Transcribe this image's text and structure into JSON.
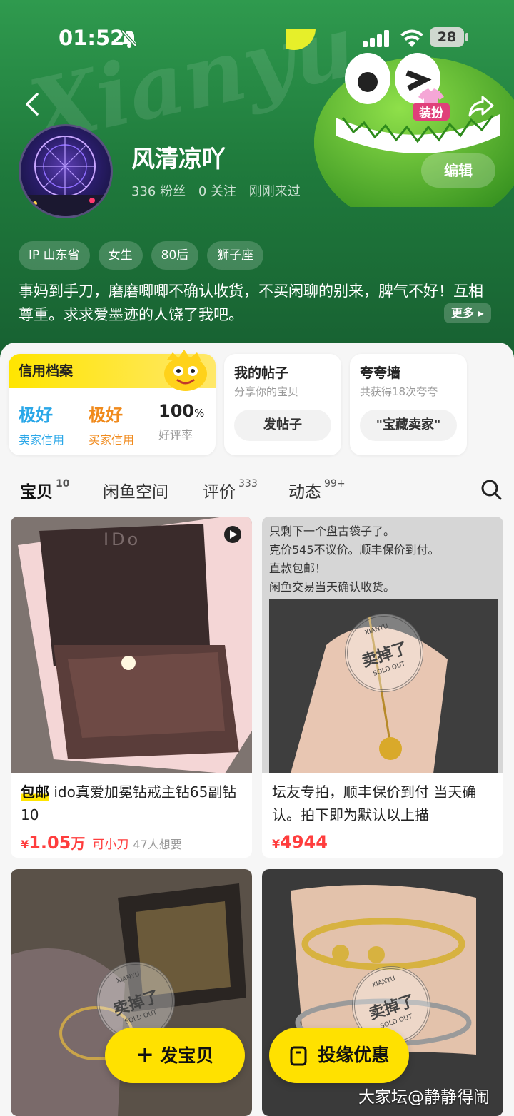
{
  "status_bar": {
    "time": "01:52",
    "battery": "28"
  },
  "header": {
    "background_text": "Xianyu",
    "dress_label": "装扮"
  },
  "profile": {
    "username": "风清凉吖",
    "fans": "336 粉丝",
    "following": "0 关注",
    "last_seen": "刚刚来过",
    "edit_label": "编辑",
    "tags": [
      "IP 山东省",
      "女生",
      "80后",
      "狮子座"
    ],
    "bio": "事妈到手刀，磨磨唧唧不确认收货，不买闲聊的别来，脾气不好！互相尊重。求求爱墨迹的人饶了我吧。",
    "more_label": "更多"
  },
  "credit": {
    "title": "信用档案",
    "seller_rating": "极好",
    "seller_label": "卖家信用",
    "buyer_rating": "极好",
    "buyer_label": "买家信用",
    "good_rate": "100",
    "good_rate_unit": "%",
    "good_rate_label": "好评率"
  },
  "posts_card": {
    "title": "我的帖子",
    "subtitle": "分享你的宝贝",
    "button": "发帖子"
  },
  "wall_card": {
    "title": "夸夸墙",
    "subtitle": "共获得18次夸夸",
    "button": "\"宝藏卖家\""
  },
  "tabs": [
    {
      "label": "宝贝",
      "count": "10"
    },
    {
      "label": "闲鱼空间",
      "count": ""
    },
    {
      "label": "评价",
      "count": "333"
    },
    {
      "label": "动态",
      "count": "99+"
    }
  ],
  "items": [
    {
      "badge": "包邮",
      "title": " ido真爱加冕钻戒主钻65副钻10",
      "currency": "¥",
      "price": "1.05",
      "price_unit": "万",
      "tip": "可小刀",
      "want": "47人想要",
      "image_text": "IDo"
    },
    {
      "title": "坛友专拍，顺丰保价到付  当天确认。拍下即为默认以上描",
      "currency": "¥",
      "price": "4944",
      "image_lines": [
        "只剩下一个盘古袋子了。",
        "克价545不议价。顺丰保价到付。",
        "直款包邮！",
        "闲鱼交易当天确认收货。"
      ],
      "stamp": {
        "top": "XIANYU",
        "main": "卖掉了",
        "bottom": "SOLD OUT"
      }
    },
    {
      "stamp": {
        "top": "XIANYU",
        "main": "卖掉了",
        "bottom": "SOLD OUT"
      }
    },
    {
      "stamp": {
        "top": "XIANYU",
        "main": "卖掉了",
        "bottom": "SOLD OUT"
      }
    }
  ],
  "fab": {
    "post": "发宝贝",
    "promo": "投缘优惠"
  },
  "watermark": "大家坛@静静得闹",
  "colors": {
    "brand_yellow": "#ffe500",
    "header_green": "#1f7a3c",
    "price_red": "#ff3d3d",
    "buyer_orange": "#f08a1c",
    "seller_blue": "#2aa7e8"
  }
}
